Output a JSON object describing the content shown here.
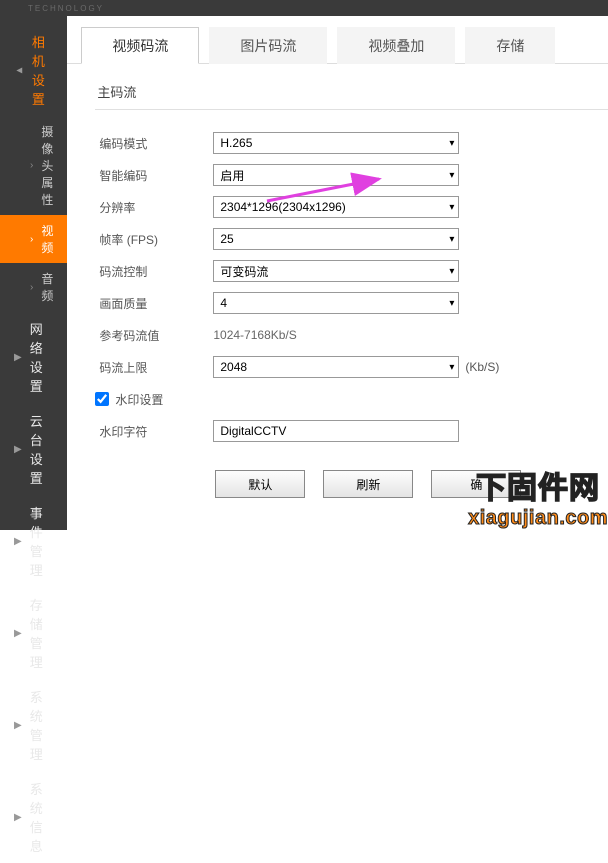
{
  "brand_sub": "TECHNOLOGY",
  "sidebar": {
    "groups": [
      {
        "label": "相机设置",
        "expanded": true,
        "current": true,
        "items": [
          {
            "label": "摄像头属性",
            "active": false
          },
          {
            "label": "视频",
            "active": true
          },
          {
            "label": "音频",
            "active": false
          }
        ]
      },
      {
        "label": "网络设置",
        "expanded": false
      },
      {
        "label": "云台设置",
        "expanded": false
      },
      {
        "label": "事件管理",
        "expanded": false
      },
      {
        "label": "存储管理",
        "expanded": false
      },
      {
        "label": "系统管理",
        "expanded": false
      },
      {
        "label": "系统信息",
        "expanded": false
      }
    ]
  },
  "tabs": [
    {
      "label": "视频码流",
      "active": true
    },
    {
      "label": "图片码流",
      "active": false
    },
    {
      "label": "视频叠加",
      "active": false
    },
    {
      "label": "存储",
      "active": false
    }
  ],
  "panel": {
    "title": "主码流",
    "encode_mode": {
      "label": "编码模式",
      "value": "H.265"
    },
    "smart_encode": {
      "label": "智能编码",
      "value": "启用"
    },
    "resolution": {
      "label": "分辨率",
      "value": "2304*1296(2304x1296)"
    },
    "fps": {
      "label": "帧率 (FPS)",
      "value": "25"
    },
    "bitrate_ctrl": {
      "label": "码流控制",
      "value": "可变码流"
    },
    "quality": {
      "label": "画面质量",
      "value": "4"
    },
    "ref_bitrate": {
      "label": "参考码流值",
      "value": "1024-7168Kb/S"
    },
    "bitrate_max": {
      "label": "码流上限",
      "value": "2048",
      "unit": "(Kb/S)"
    },
    "watermark_cfg": {
      "label": "水印设置",
      "checked": true
    },
    "watermark_text": {
      "label": "水印字符",
      "value": "DigitalCCTV"
    }
  },
  "buttons": {
    "default": "默认",
    "refresh": "刷新",
    "confirm": "确"
  },
  "site_watermark": {
    "line1": "下固件网",
    "line2": "xiagujian.com"
  }
}
